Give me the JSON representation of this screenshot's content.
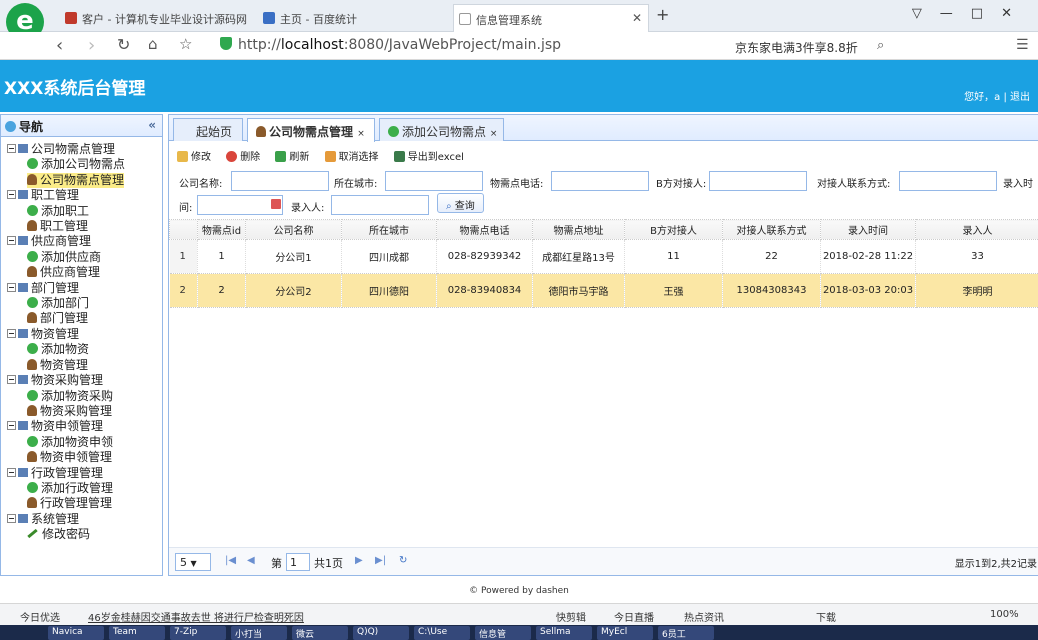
{
  "browser": {
    "tabs": [
      {
        "label": "客户 - 计算机专业毕业设计源码网"
      },
      {
        "label": "主页 - 百度统计"
      },
      {
        "label": "信息管理系统"
      }
    ],
    "new_tab": "+",
    "url_prefix": "http://",
    "url_host": "localhost",
    "url_rest": ":8080/JavaWebProject/main.jsp",
    "promo": "京东家电满3件享8.8折"
  },
  "header": {
    "title": "XXX系统后台管理",
    "user_text": "您好，a | 退出"
  },
  "nav": {
    "title": "导航",
    "groups": [
      {
        "label": "公司物需点管理",
        "items": [
          {
            "label": "添加公司物需点",
            "icon": "add"
          },
          {
            "label": "公司物需点管理",
            "icon": "man",
            "active": true
          }
        ]
      },
      {
        "label": "职工管理",
        "items": [
          {
            "label": "添加职工",
            "icon": "add"
          },
          {
            "label": "职工管理",
            "icon": "man"
          }
        ]
      },
      {
        "label": "供应商管理",
        "items": [
          {
            "label": "添加供应商",
            "icon": "add"
          },
          {
            "label": "供应商管理",
            "icon": "man"
          }
        ]
      },
      {
        "label": "部门管理",
        "items": [
          {
            "label": "添加部门",
            "icon": "add"
          },
          {
            "label": "部门管理",
            "icon": "man"
          }
        ]
      },
      {
        "label": "物资管理",
        "items": [
          {
            "label": "添加物资",
            "icon": "add"
          },
          {
            "label": "物资管理",
            "icon": "man"
          }
        ]
      },
      {
        "label": "物资采购管理",
        "items": [
          {
            "label": "添加物资采购",
            "icon": "add"
          },
          {
            "label": "物资采购管理",
            "icon": "man"
          }
        ]
      },
      {
        "label": "物资申领管理",
        "items": [
          {
            "label": "添加物资申领",
            "icon": "add"
          },
          {
            "label": "物资申领管理",
            "icon": "man"
          }
        ]
      },
      {
        "label": "行政管理管理",
        "items": [
          {
            "label": "添加行政管理",
            "icon": "add"
          },
          {
            "label": "行政管理管理",
            "icon": "man"
          }
        ]
      },
      {
        "label": "系统管理",
        "items": [
          {
            "label": "修改密码",
            "icon": "pen"
          }
        ]
      }
    ]
  },
  "main": {
    "tabs": [
      {
        "label": "起始页"
      },
      {
        "label": "公司物需点管理"
      },
      {
        "label": "添加公司物需点"
      }
    ],
    "toolbar": {
      "edit": "修改",
      "delete": "删除",
      "refresh": "刷新",
      "cancel": "取消选择",
      "export": "导出到excel"
    },
    "search": {
      "company": "公司名称:",
      "city": "所在城市:",
      "phone": "物需点电话:",
      "contact": "B方对接人:",
      "contact_phone": "对接人联系方式:",
      "time_a": "录入时",
      "time_b": "间:",
      "recorder": "录入人:",
      "button": "查询"
    },
    "grid": {
      "columns": [
        "物需点id",
        "公司名称",
        "所在城市",
        "物需点电话",
        "物需点地址",
        "B方对接人",
        "对接人联系方式",
        "录入时间",
        "录入人"
      ],
      "rows": [
        {
          "rn": "1",
          "cells": [
            "1",
            "分公司1",
            "四川成都",
            "028-82939342",
            "成都红星路13号",
            "11",
            "22",
            "2018-02-28 11:22",
            "33"
          ]
        },
        {
          "rn": "2",
          "cells": [
            "2",
            "分公司2",
            "四川德阳",
            "028-83940834",
            "德阳市马宇路",
            "王强",
            "13084308343",
            "2018-03-03 20:03",
            "李明明"
          ],
          "selected": true
        }
      ]
    },
    "pager": {
      "page_size": "5",
      "page_label": "第",
      "page_value": "1",
      "page_total": "共1页",
      "info": "显示1到2,共2记录"
    }
  },
  "footer": "© Powered by dashen",
  "statusbar": {
    "left": "今日优选",
    "news": "46岁金桂赫因交通事故去世 将进行尸检查明死因",
    "items": [
      "快剪辑",
      "今日直播",
      "热点资讯",
      "下载",
      "100%"
    ]
  },
  "taskbar": [
    "Navica",
    "Team",
    "7-Zip",
    "小打当",
    "微云",
    "Q)Q)",
    "C:\\Use",
    "信息管",
    "Sellma",
    "MyEcl",
    "6员工"
  ]
}
